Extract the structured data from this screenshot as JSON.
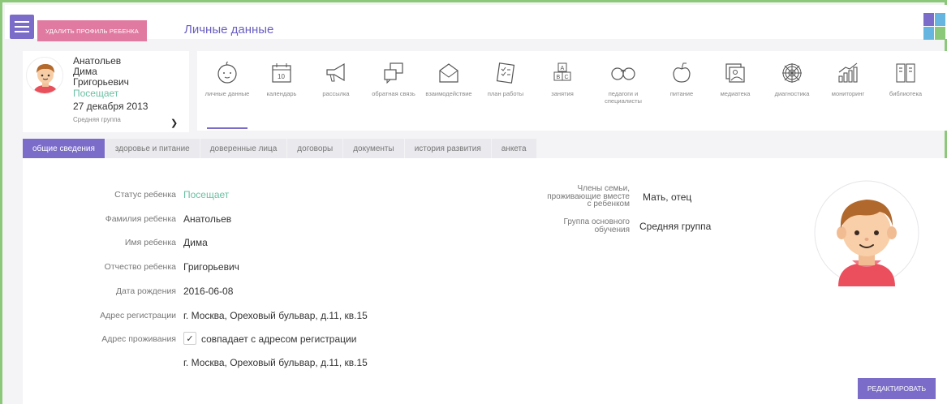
{
  "header": {
    "delete_button": "удалить профиль ребенка",
    "title": "Личные данные"
  },
  "profile": {
    "surname": "Анатольев",
    "name": "Дима",
    "patronymic": "Григорьевич",
    "status": "Посещает",
    "dob": "27 декабря 2013",
    "group": "Средняя группа"
  },
  "menu": [
    {
      "label": "личные данные",
      "icon": "baby-face-icon"
    },
    {
      "label": "календарь",
      "icon": "calendar-icon"
    },
    {
      "label": "рассылка",
      "icon": "megaphone-icon"
    },
    {
      "label": "обратная связь",
      "icon": "feedback-icon"
    },
    {
      "label": "взаимодействие",
      "icon": "envelope-icon"
    },
    {
      "label": "план работы",
      "icon": "plan-icon"
    },
    {
      "label": "занятия",
      "icon": "abc-blocks-icon"
    },
    {
      "label": "педагоги и специалисты",
      "icon": "glasses-icon"
    },
    {
      "label": "питание",
      "icon": "apple-icon"
    },
    {
      "label": "медиатека",
      "icon": "media-icon"
    },
    {
      "label": "диагностика",
      "icon": "web-icon"
    },
    {
      "label": "мониторинг",
      "icon": "chart-icon"
    },
    {
      "label": "библиотека",
      "icon": "book-icon"
    }
  ],
  "tabs": [
    "общие сведения",
    "здоровье и питание",
    "доверенные лица",
    "договоры",
    "документы",
    "история развития",
    "анкета"
  ],
  "fields": {
    "status_label": "Статус ребенка",
    "status_value": "Посещает",
    "surname_label": "Фамилия ребенка",
    "surname_value": "Анатольев",
    "name_label": "Имя ребенка",
    "name_value": "Дима",
    "patronymic_label": "Отчество ребенка",
    "patronymic_value": "Григорьевич",
    "dob_label": "Дата рождения",
    "dob_value": "2016-06-08",
    "reg_label": "Адрес регистрации",
    "reg_value": "г. Москва, Ореховый бульвар, д.11, кв.15",
    "live_label": "Адрес проживания",
    "live_checkbox": "совпадает с адресом регистрации",
    "live_checked": true,
    "live_value": "г. Москва, Ореховый бульвар, д.11, кв.15"
  },
  "right_fields": {
    "family_label_1": "Члены семьи,",
    "family_label_2": "проживающие вместе",
    "family_label_3": "с ребенком",
    "family_value": "Мать, отец",
    "group_label_1": "Группа основного",
    "group_label_2": "обучения",
    "group_value": "Средняя группа"
  },
  "edit_button": "редактировать",
  "colors": {
    "accent": "#7b6cc9",
    "delete": "#e07aa0",
    "status_green": "#6cc0a5",
    "frame_green": "#8bc87a"
  }
}
